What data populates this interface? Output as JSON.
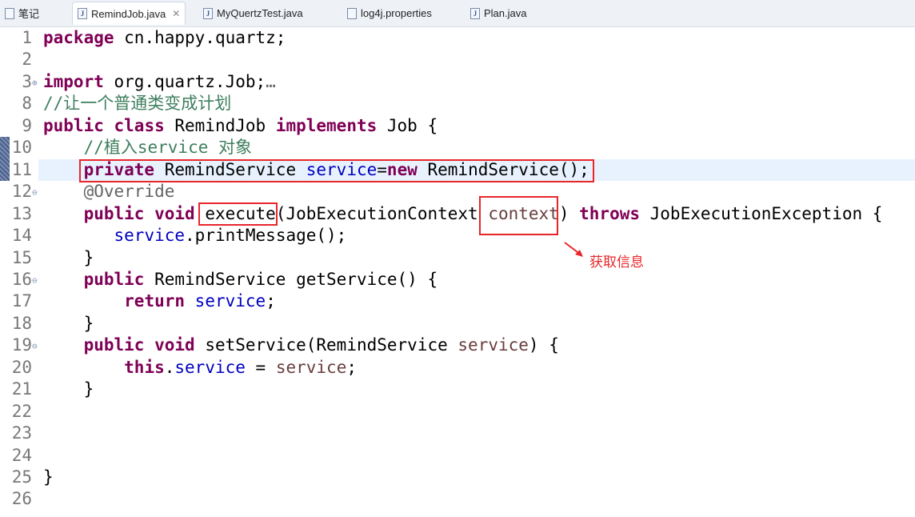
{
  "tabs": [
    {
      "label": "笔记",
      "icon": "note-file-icon",
      "active": false
    },
    {
      "label": "RemindJob.java",
      "icon": "java-file-icon",
      "active": true,
      "close": "✕"
    },
    {
      "label": "MyQuertzTest.java",
      "icon": "java-file-icon",
      "active": false
    },
    {
      "label": "log4j.properties",
      "icon": "properties-file-icon",
      "active": false
    },
    {
      "label": "Plan.java",
      "icon": "java-file-icon",
      "active": false
    }
  ],
  "colors": {
    "keyword": "#7f0055",
    "field": "#0000c0",
    "parameter": "#6a3e3e",
    "comment": "#3f7f5f",
    "annotation": "#646464",
    "highlight": "#e8f2fe",
    "callout": "#e8262a"
  },
  "lines": [
    {
      "n": "1",
      "tokens": [
        {
          "t": "package",
          "c": "kw"
        },
        {
          "t": " cn.happy.quartz;",
          "c": "plain"
        }
      ]
    },
    {
      "n": "2",
      "tokens": []
    },
    {
      "n": "3",
      "fold": "⊕",
      "tokens": [
        {
          "t": "import",
          "c": "kw"
        },
        {
          "t": " org.quartz.Job;",
          "c": "plain"
        },
        {
          "t": "…",
          "c": "ann"
        }
      ]
    },
    {
      "n": "8",
      "tokens": [
        {
          "t": "//让一个普通类变成计划",
          "c": "cmt"
        }
      ]
    },
    {
      "n": "9",
      "tokens": [
        {
          "t": "public",
          "c": "kw"
        },
        {
          "t": " ",
          "c": "plain"
        },
        {
          "t": "class",
          "c": "kw"
        },
        {
          "t": " RemindJob ",
          "c": "plain"
        },
        {
          "t": "implements",
          "c": "kw"
        },
        {
          "t": " Job {",
          "c": "plain"
        }
      ]
    },
    {
      "n": "10",
      "tokens": [
        {
          "t": "    //植入service 对象",
          "c": "cmt"
        }
      ]
    },
    {
      "n": "11",
      "current": true,
      "tokens": [
        {
          "t": "    ",
          "c": "plain"
        },
        {
          "t": "private",
          "c": "kw"
        },
        {
          "t": " RemindService ",
          "c": "plain"
        },
        {
          "t": "service",
          "c": "fld"
        },
        {
          "t": "=",
          "c": "plain"
        },
        {
          "t": "new",
          "c": "kw"
        },
        {
          "t": " RemindService();",
          "c": "plain"
        }
      ]
    },
    {
      "n": "12",
      "fold": "⊖",
      "tokens": [
        {
          "t": "    @Override",
          "c": "ann"
        }
      ]
    },
    {
      "n": "13",
      "tokens": [
        {
          "t": "    ",
          "c": "plain"
        },
        {
          "t": "public",
          "c": "kw"
        },
        {
          "t": " ",
          "c": "plain"
        },
        {
          "t": "void",
          "c": "kw"
        },
        {
          "t": " execute(JobExecutionContext ",
          "c": "plain"
        },
        {
          "t": "context",
          "c": "par"
        },
        {
          "t": ") ",
          "c": "plain"
        },
        {
          "t": "throws",
          "c": "kw"
        },
        {
          "t": " JobExecutionException {",
          "c": "plain"
        }
      ]
    },
    {
      "n": "14",
      "tokens": [
        {
          "t": "       ",
          "c": "plain"
        },
        {
          "t": "service",
          "c": "fld"
        },
        {
          "t": ".printMessage();",
          "c": "plain"
        }
      ]
    },
    {
      "n": "15",
      "tokens": [
        {
          "t": "    }",
          "c": "plain"
        }
      ]
    },
    {
      "n": "16",
      "fold": "⊖",
      "tokens": [
        {
          "t": "    ",
          "c": "plain"
        },
        {
          "t": "public",
          "c": "kw"
        },
        {
          "t": " RemindService getService() {",
          "c": "plain"
        }
      ]
    },
    {
      "n": "17",
      "tokens": [
        {
          "t": "        ",
          "c": "plain"
        },
        {
          "t": "return",
          "c": "kw"
        },
        {
          "t": " ",
          "c": "plain"
        },
        {
          "t": "service",
          "c": "fld"
        },
        {
          "t": ";",
          "c": "plain"
        }
      ]
    },
    {
      "n": "18",
      "tokens": [
        {
          "t": "    }",
          "c": "plain"
        }
      ]
    },
    {
      "n": "19",
      "fold": "⊖",
      "tokens": [
        {
          "t": "    ",
          "c": "plain"
        },
        {
          "t": "public",
          "c": "kw"
        },
        {
          "t": " ",
          "c": "plain"
        },
        {
          "t": "void",
          "c": "kw"
        },
        {
          "t": " setService(RemindService ",
          "c": "plain"
        },
        {
          "t": "service",
          "c": "par"
        },
        {
          "t": ") {",
          "c": "plain"
        }
      ]
    },
    {
      "n": "20",
      "tokens": [
        {
          "t": "        ",
          "c": "plain"
        },
        {
          "t": "this",
          "c": "kw"
        },
        {
          "t": ".",
          "c": "plain"
        },
        {
          "t": "service",
          "c": "fld"
        },
        {
          "t": " = ",
          "c": "plain"
        },
        {
          "t": "service",
          "c": "par"
        },
        {
          "t": ";",
          "c": "plain"
        }
      ]
    },
    {
      "n": "21",
      "tokens": [
        {
          "t": "    }",
          "c": "plain"
        }
      ]
    },
    {
      "n": "22",
      "tokens": []
    },
    {
      "n": "23",
      "tokens": []
    },
    {
      "n": "24",
      "tokens": []
    },
    {
      "n": "25",
      "tokens": [
        {
          "t": "}",
          "c": "plain"
        }
      ]
    },
    {
      "n": "26",
      "tokens": []
    }
  ],
  "callout": {
    "text": "获取信息"
  }
}
